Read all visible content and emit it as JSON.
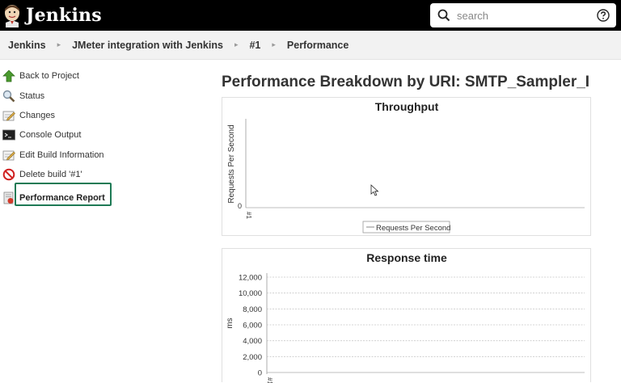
{
  "header": {
    "brand": "Jenkins",
    "search_placeholder": "search"
  },
  "breadcrumb": [
    "Jenkins",
    "JMeter integration with Jenkins",
    "#1",
    "Performance"
  ],
  "sidebar": {
    "items": [
      {
        "label": "Back to Project",
        "icon": "up-arrow-icon"
      },
      {
        "label": "Status",
        "icon": "magnifier-icon"
      },
      {
        "label": "Changes",
        "icon": "notepad-icon"
      },
      {
        "label": "Console Output",
        "icon": "terminal-icon"
      },
      {
        "label": "Edit Build Information",
        "icon": "notepad-edit-icon"
      },
      {
        "label": "Delete build '#1'",
        "icon": "no-entry-icon"
      },
      {
        "label": "Performance Report",
        "icon": "report-icon"
      }
    ]
  },
  "main": {
    "title": "Performance Breakdown by URI: SMTP_Sampler_I"
  },
  "charts": [
    {
      "type": "line",
      "title": "Throughput",
      "ylabel": "Requests Per Second",
      "y_ticks": [
        "0"
      ],
      "x_categories": [
        "#1"
      ],
      "legend": "Requests Per Second"
    },
    {
      "type": "line",
      "title": "Response time",
      "ylabel": "ms",
      "y_ticks": [
        "0",
        "2,000",
        "4,000",
        "6,000",
        "8,000",
        "10,000",
        "12,000"
      ],
      "x_categories": [
        "#1"
      ]
    }
  ],
  "colors": {
    "header_bg": "#000000",
    "breadcrumb_bg": "#f2f2f2",
    "active_highlight": "#1e7a55"
  }
}
